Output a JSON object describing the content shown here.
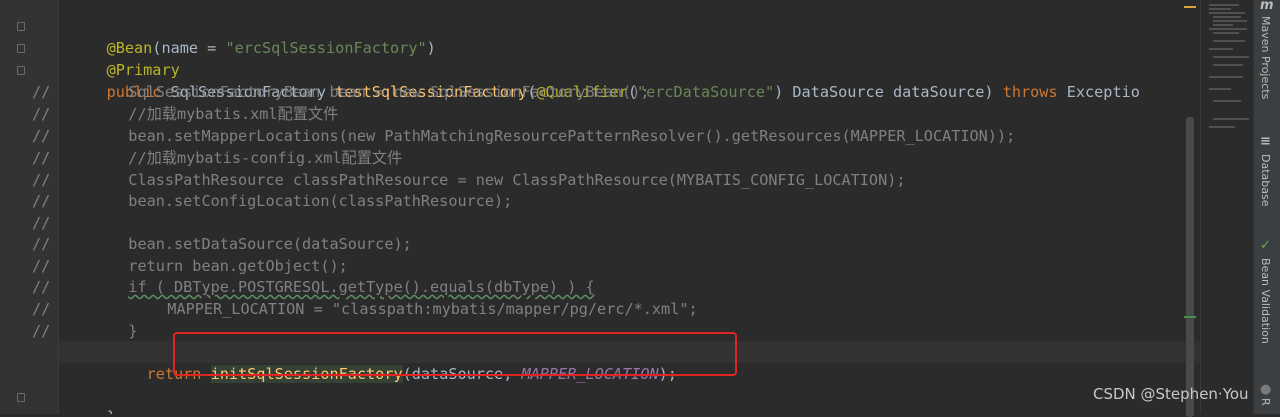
{
  "editor": {
    "lines": [
      {
        "comment_prefix": "",
        "code": "@Bean(name = \"ercSqlSessionFactory\")"
      },
      {
        "comment_prefix": "",
        "code": "@Primary"
      },
      {
        "comment_prefix": "",
        "code": "public SqlSessionFactory testSqlSessionFactory(@Qualifier(\"ercDataSource\") DataSource dataSource) throws Exceptio"
      },
      {
        "comment_prefix": "//",
        "code": "SqlSessionFactoryBean bean = new SqlSessionFactoryBean();"
      },
      {
        "comment_prefix": "//",
        "code": "//加载mybatis.xml配置文件"
      },
      {
        "comment_prefix": "//",
        "code": "bean.setMapperLocations(new PathMatchingResourcePatternResolver().getResources(MAPPER_LOCATION));"
      },
      {
        "comment_prefix": "//",
        "code": "//加载mybatis-config.xml配置文件"
      },
      {
        "comment_prefix": "//",
        "code": "ClassPathResource classPathResource = new ClassPathResource(MYBATIS_CONFIG_LOCATION);"
      },
      {
        "comment_prefix": "//",
        "code": "bean.setConfigLocation(classPathResource);"
      },
      {
        "comment_prefix": "//",
        "code": ""
      },
      {
        "comment_prefix": "//",
        "code": "bean.setDataSource(dataSource);"
      },
      {
        "comment_prefix": "//",
        "code": "return bean.getObject();"
      },
      {
        "comment_prefix": "//",
        "code": "if ( DBType.POSTGRESQL.getType().equals(dbType) ) {"
      },
      {
        "comment_prefix": "//",
        "code": "MAPPER_LOCATION = \"classpath:mybatis/mapper/pg/erc/*.xml\";"
      },
      {
        "comment_prefix": "//",
        "code": "}"
      },
      {
        "comment_prefix": "",
        "code": "return initSqlSessionFactory(dataSource, MAPPER_LOCATION);"
      },
      {
        "comment_prefix": "",
        "code": ""
      },
      {
        "comment_prefix": "",
        "code": "}"
      }
    ],
    "tokens": {
      "l0": [
        "@Bean",
        "(name = ",
        "\"ercSqlSessionFactory\"",
        ")"
      ],
      "l1": [
        "@Primary"
      ],
      "l2": [
        "public ",
        "SqlSessionFactory ",
        "testSqlSessionFactory",
        "(",
        "@Qualifier",
        "(",
        "\"ercDataSource\"",
        ") DataSource dataSource) ",
        "throws ",
        "Exceptio"
      ],
      "l15": [
        "return ",
        "initSqlSessionFactory",
        "(dataSource, ",
        "MAPPER_LOCATION",
        ");"
      ]
    }
  },
  "toolstrip": {
    "maven_icon": "m",
    "maven_label": "Maven Projects",
    "database_label": "Database",
    "bean_label": "Bean Validation",
    "r_label": "R"
  },
  "colors": {
    "background": "#2b2b2b",
    "keyword": "#cc7832",
    "annotation": "#bbb529",
    "string": "#6a8759",
    "method": "#ffc66d",
    "comment": "#808080",
    "constant": "#9876aa",
    "highlight_box": "#e02424"
  },
  "watermark": "CSDN @Stephen·You"
}
